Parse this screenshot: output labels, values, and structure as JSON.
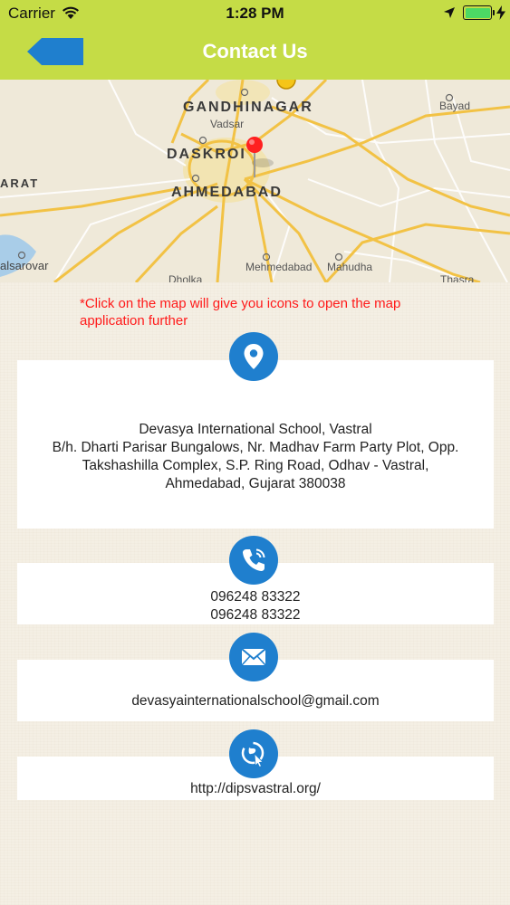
{
  "status_bar": {
    "carrier": "Carrier",
    "time": "1:28 PM",
    "battery_color": "#4cd964"
  },
  "header": {
    "title": "Contact Us",
    "background_color": "#c5dc46",
    "back_icon": "back-arrow-icon"
  },
  "map": {
    "labels": {
      "gandhinagar": "GANDHINAGAR",
      "vadsar": "Vadsar",
      "bayad": "Bayad",
      "daskroi": "DASKROI",
      "ahmedabad": "AHMEDABAD",
      "arat": "ARAT",
      "alsarovar": "alsarovar",
      "mehmedabad": "Mehmedabad",
      "mahudha": "Mahudha",
      "dholka": "Dholka",
      "thasra": "Thasra"
    },
    "pin_color": "#ff2020"
  },
  "note": "*Click on the map will give you icons to open the map application further",
  "contact": {
    "address": {
      "icon": "location-pin-icon",
      "line1": "Devasya International School, Vastral",
      "line2": "B/h. Dharti Parisar Bungalows, Nr. Madhav Farm Party Plot, Opp.",
      "line3": "Takshashilla Complex, S.P. Ring Road, Odhav - Vastral,",
      "line4": "Ahmedabad, Gujarat 380038"
    },
    "phone": {
      "icon": "phone-icon",
      "number1": "096248 83322",
      "number2": "096248 83322"
    },
    "email": {
      "icon": "envelope-icon",
      "address": "devasyainternationalschool@gmail.com"
    },
    "website": {
      "icon": "globe-cursor-icon",
      "url": "http://dipsvastral.org/"
    }
  },
  "accent_color": "#1f7fce",
  "note_color": "#ff1a1a"
}
